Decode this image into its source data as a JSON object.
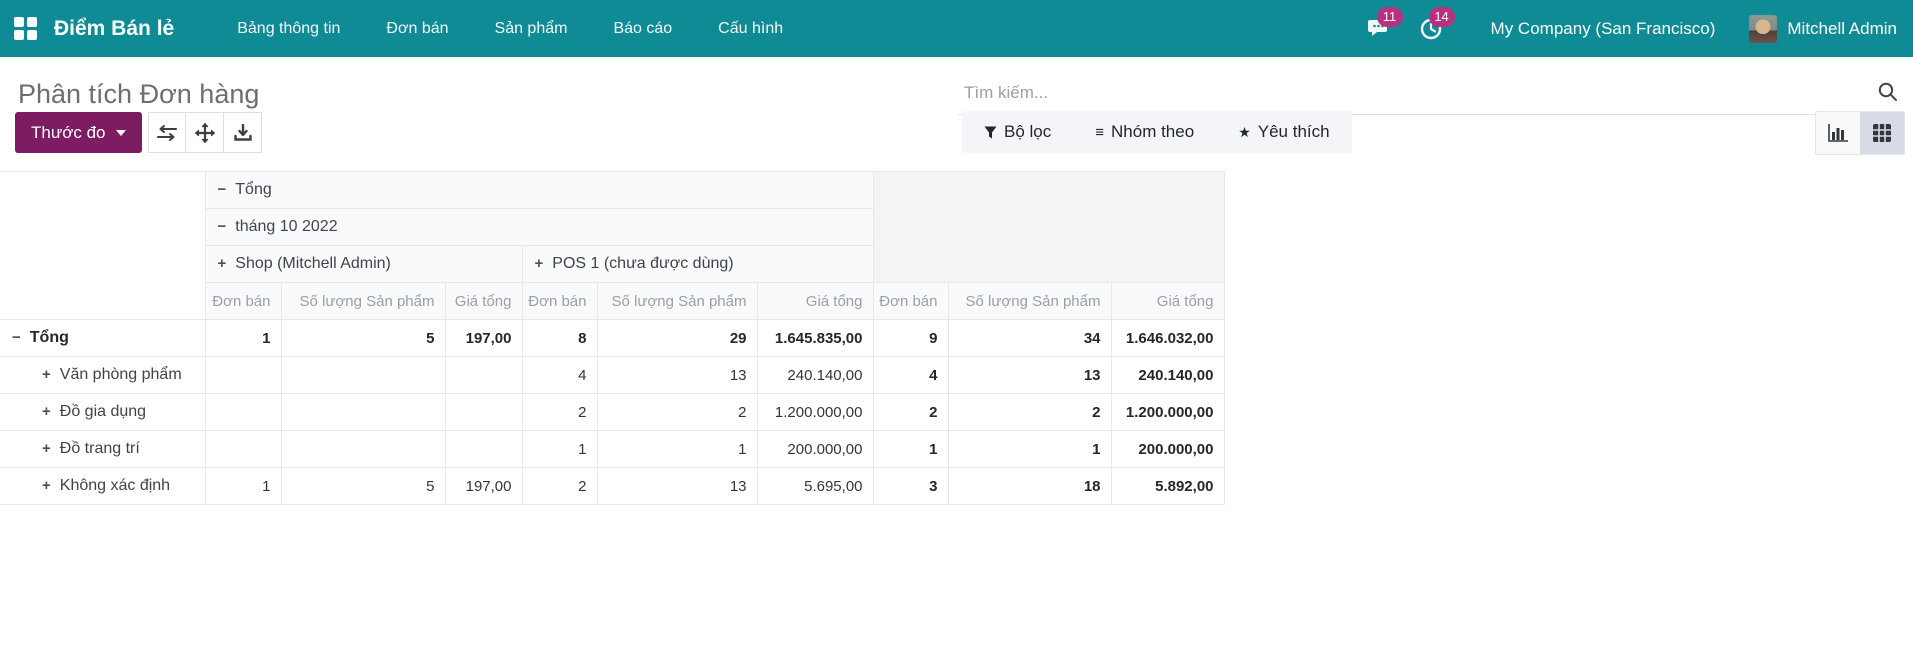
{
  "navbar": {
    "app_title": "Điểm Bán lẻ",
    "menu_items": [
      {
        "label": "Bảng thông tin"
      },
      {
        "label": "Đơn bán"
      },
      {
        "label": "Sản phẩm"
      },
      {
        "label": "Báo cáo"
      },
      {
        "label": "Cấu hình"
      }
    ],
    "messages_badge": "11",
    "activities_badge": "14",
    "company": "My Company (San Francisco)",
    "user": "Mitchell Admin"
  },
  "control_panel": {
    "title": "Phân tích Đơn hàng",
    "search_placeholder": "Tìm kiếm...",
    "measures_button": "Thước đo",
    "filter_label": "Bộ lọc",
    "group_by_label": "Nhóm theo",
    "favorites_label": "Yêu thích"
  },
  "icons": {
    "collapse": "−",
    "expand": "+",
    "star": "★",
    "bars": "≡"
  },
  "colors": {
    "navbar_teal": "#0e8b94",
    "badge_magenta": "#b8307f",
    "measures_button_purple": "#7d1c63",
    "active_view_bg": "#d7dbe8"
  },
  "pivot": {
    "col_root": "Tổng",
    "col_month": "tháng 10 2022",
    "col_subgroups": [
      {
        "label": "Shop (Mitchell Admin)"
      },
      {
        "label": "POS 1 (chưa được dùng)"
      }
    ],
    "measures": [
      "Đơn bán",
      "Số lượng Sản phẩm",
      "Giá tổng"
    ],
    "rows": [
      {
        "label": "Tổng",
        "values": [
          "1",
          "5",
          "197,00",
          "8",
          "29",
          "1.645.835,00",
          "9",
          "34",
          "1.646.032,00"
        ]
      },
      {
        "label": "Văn phòng phẩm",
        "values": [
          "",
          "",
          "",
          "4",
          "13",
          "240.140,00",
          "4",
          "13",
          "240.140,00"
        ]
      },
      {
        "label": "Đồ gia dụng",
        "values": [
          "",
          "",
          "",
          "2",
          "2",
          "1.200.000,00",
          "2",
          "2",
          "1.200.000,00"
        ]
      },
      {
        "label": "Đồ trang trí",
        "values": [
          "",
          "",
          "",
          "1",
          "1",
          "200.000,00",
          "1",
          "1",
          "200.000,00"
        ]
      },
      {
        "label": "Không xác định",
        "values": [
          "1",
          "5",
          "197,00",
          "2",
          "13",
          "5.695,00",
          "3",
          "18",
          "5.892,00"
        ]
      }
    ]
  }
}
